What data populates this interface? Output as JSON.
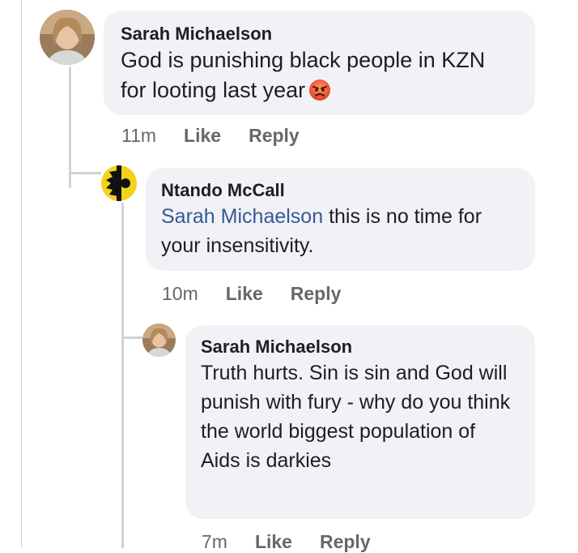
{
  "comments": [
    {
      "author": "Sarah Michaelson",
      "text": "God is punishing black people in KZN for looting last year",
      "emoji": "angry-face-emoji",
      "time": "11m",
      "like": "Like",
      "reply": "Reply"
    },
    {
      "author": "Ntando McCall",
      "mention": "Sarah Michaelson",
      "text": " this is no time for your insensitivity.",
      "time": "10m",
      "like": "Like",
      "reply": "Reply"
    },
    {
      "author": "Sarah Michaelson",
      "text": "Truth hurts. Sin is sin and God will punish with fury - why do you think the world biggest population of Aids is darkies",
      "time": "7m",
      "like": "Like",
      "reply": "Reply"
    }
  ],
  "colors": {
    "bubble": "#f0f2f5",
    "mention": "#385898",
    "muted": "#65676b",
    "thread_line": "#cfd2d6"
  }
}
